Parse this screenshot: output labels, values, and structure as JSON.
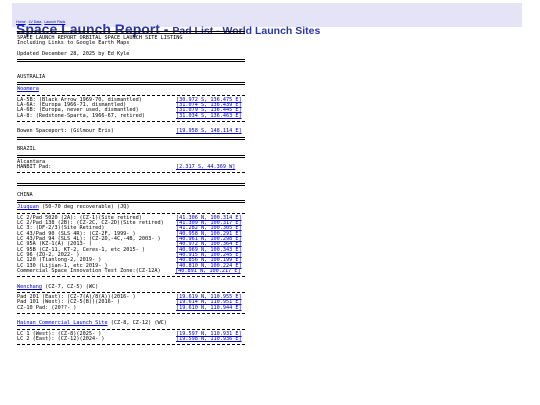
{
  "header": {
    "title": "Space Launch Report - ",
    "subtitle": "Pad List - World Launch Sites",
    "nav": [
      "Home",
      "LV Data",
      "Launch Pads"
    ],
    "colors": {
      "banner_bg": "#e4e4f6",
      "title": "#2a36a8",
      "link": "#0000cc"
    }
  },
  "intro": {
    "line1": "SPACE LAUNCH REPORT ORBITAL SPACE LAUNCH SITE LISTING",
    "line2": "Including Links to Google Earth Maps",
    "updated": "Updated December 28, 2025 by Ed Kyle"
  },
  "australia": {
    "country": "AUSTRALIA",
    "site": "Woomera",
    "pads": [
      {
        "name": "LA-5B: (Black Arrow 1969-70, dismantled)",
        "coord": "[30.972 S, 136.475 E]"
      },
      {
        "name": "LA-6A: (Europa 1966-71, dismantled)",
        "coord": "[31.074 S, 136.439 E]"
      },
      {
        "name": "LA-6B: (Europa, never used, dismantled)",
        "coord": "[31.079 S, 136.445 E]"
      },
      {
        "name": "LA-8: (Redstone-Sparta, 1966-67, retired)",
        "coord": "[31.034 S, 136.463 E]"
      }
    ],
    "extra": {
      "name": "Bowen Spaceport: (Gilmour Eris)",
      "coord": "[19.958 S, 148.114 E]"
    }
  },
  "brazil": {
    "country": "BRAZIL",
    "site": "Alcantara",
    "pad": {
      "name": "HANBIT Pad:",
      "coord": "[2.317 S, 44.369 W]"
    }
  },
  "china": {
    "country": "CHINA",
    "jiuquan": {
      "site": "Jiuquan",
      "note": " (50-70 deg recoverable) (JQ)",
      "pads": [
        {
          "name": "LC 2/Pad 5020 (2A): (CZ-1)(Site retired)",
          "coord": "[41.306 N, 100.314 E]"
        },
        {
          "name": "LC 2/Pad 138 (2B): (CZ-2C, CZ-2D)(Site retired)",
          "coord": "[41.309 N, 100.317 E]"
        },
        {
          "name": "LC 3: (DF-2/3)(Site Retired)",
          "coord": "[41.282 N, 100.305 E]"
        },
        {
          "name": "LC 43/Pad 90 (SLS 4R): (CZ-2F, 1999- )",
          "coord": "[40.958 N, 100.291 E]"
        },
        {
          "name": "LC 43/Pad 94 (SLS 4L): (CZ-2D,-4C,-4B, 2003- )",
          "coord": "[40.961 N, 100.298 E]"
        },
        {
          "name": "LC 95A (KZ-1(A) (2013- )",
          "coord": "[40.972 N, 100.364 E]"
        },
        {
          "name": "LC 95B (CZ-11, KT-2, Ceres-1, etc 2015- )",
          "coord": "[40.969 N, 100.343 E]"
        },
        {
          "name": "LC 96 (ZQ-2, 2022- )",
          "coord": "[40.915 N, 100.245 E]"
        },
        {
          "name": "LC 120 (Tianlong-2, 2019- )",
          "coord": "[40.856 N, 100.199 E]"
        },
        {
          "name": "LC 130 (Lijian-1, etc 2019- )",
          "coord": "[40.810 N, 100.224 E]"
        },
        {
          "name": "Commercial Space Innovation Test Zone:(CZ-12A)",
          "coord": "[40.891 N, 100.217 E]"
        }
      ]
    },
    "wenchang": {
      "site": "Wenchang",
      "note": " (CZ-7, CZ-5) (WC)",
      "pads": [
        {
          "name": "Pad 201 (East): (CZ-7(A)/8(A))(2016- )",
          "coord": "[19.619 N, 110.955 E]"
        },
        {
          "name": "Pad 101 (West): (CZ-5(B))(2016- )",
          "coord": "[19.614 N, 110.951 E]"
        },
        {
          "name": "CZ-10 Pad: (20??- )",
          "coord": "[19.610 N, 110.944 E]"
        }
      ]
    },
    "hainan": {
      "site": "Hainan Commercial Launch Site",
      "note": " (CZ-8, CZ-12) (WC)",
      "pads": [
        {
          "name": "LC 1 (West): (CZ-8)(2025- )",
          "coord": "[19.597 N, 110.931 E]"
        },
        {
          "name": "LC 2 (East): (CZ-12)(2024- )",
          "coord": "[19.598 N, 110.936 E]"
        }
      ]
    }
  }
}
